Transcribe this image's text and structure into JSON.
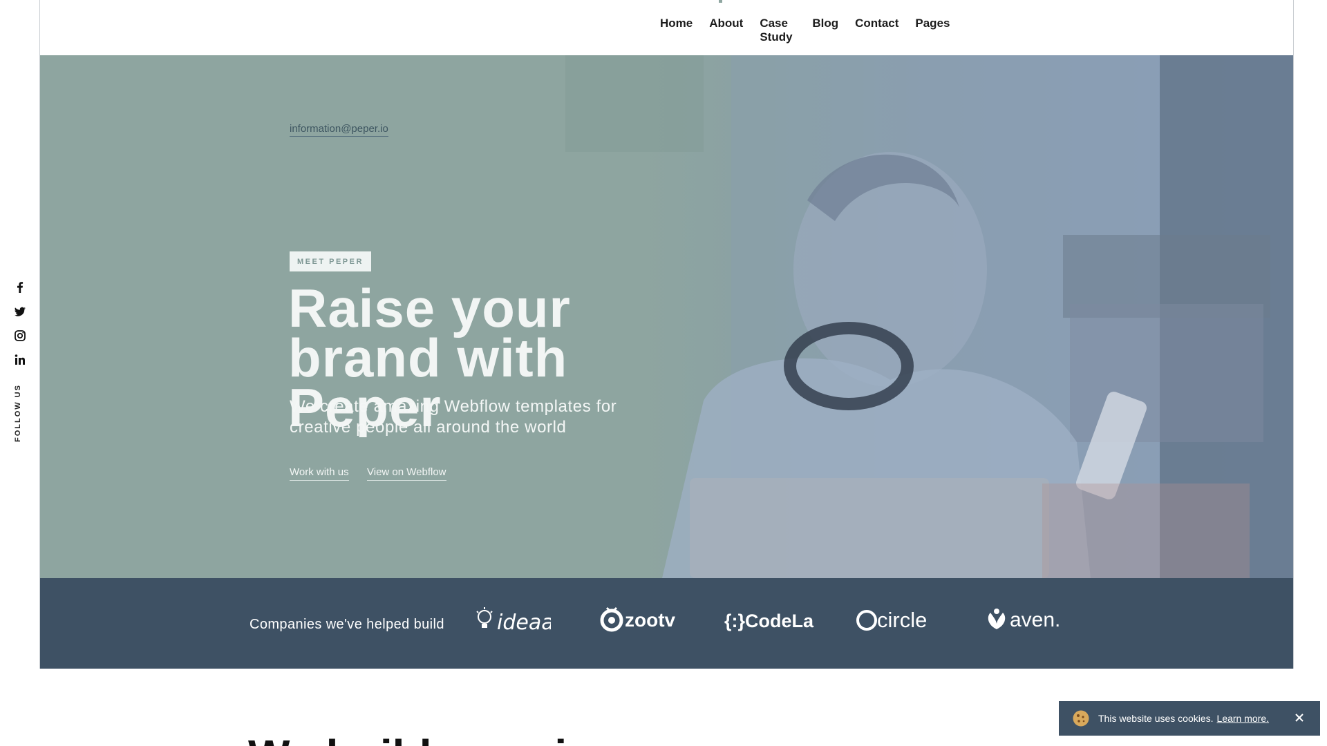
{
  "nav": {
    "items": [
      {
        "label": "Home"
      },
      {
        "label": "About"
      },
      {
        "label": "Case Study"
      },
      {
        "label": "Blog"
      },
      {
        "label": "Contact"
      },
      {
        "label": "Pages"
      }
    ]
  },
  "hero": {
    "email": "information@peper.io",
    "tag": "MEET PEPER",
    "headline": "Raise your brand with Peper",
    "subhead": "We create amazing Webflow templates for creative people all around the world",
    "cta_work": "Work with us",
    "cta_webflow": "View on Webflow"
  },
  "social": {
    "icons": [
      "facebook-icon",
      "twitter-icon",
      "instagram-icon",
      "linkedin-icon"
    ],
    "follow_label": "FOLLOW US"
  },
  "clients": {
    "label": "Companies we've helped build",
    "logos": [
      "ideaa",
      "zootv",
      "{:}CodeLab",
      "circle",
      "aven."
    ]
  },
  "below": {
    "title_fragment": "We build amazing"
  },
  "cookie": {
    "text": "This website uses cookies.",
    "link": "Learn more.",
    "close": "✕"
  },
  "colors": {
    "hero_bg": "#8ea5a0",
    "clients_bg": "#3e5164",
    "cookie_bg": "#3e5164",
    "headline": "#f2f5f4"
  }
}
